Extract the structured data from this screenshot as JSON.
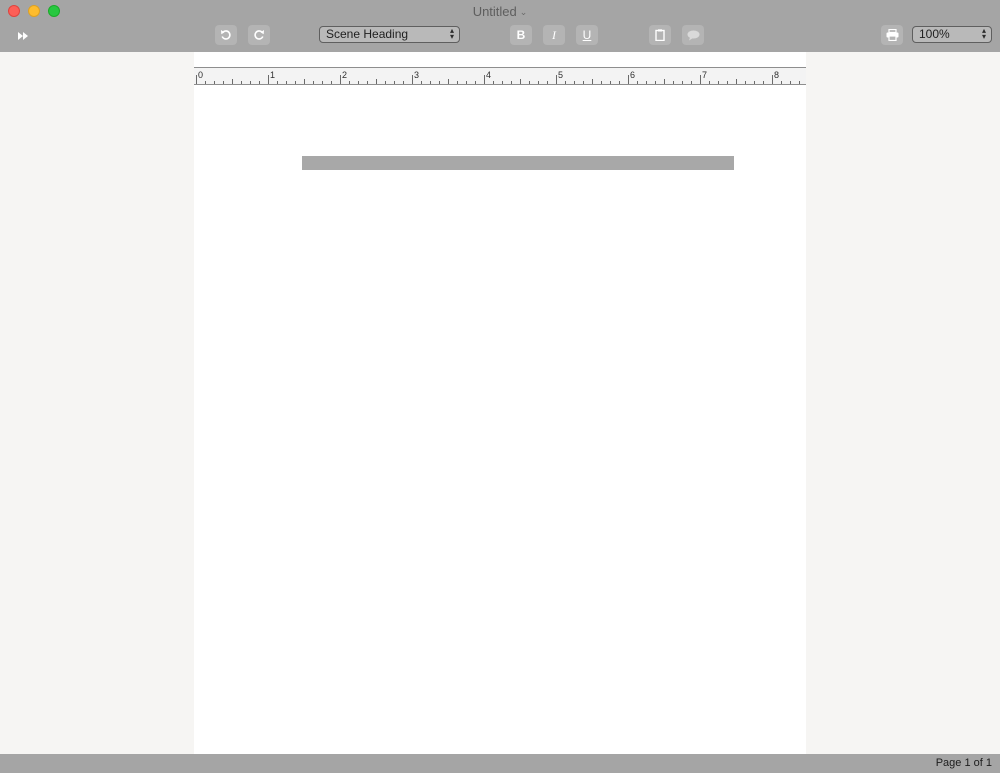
{
  "window": {
    "title": "Untitled"
  },
  "toolbar": {
    "element_type": {
      "selected": "Scene Heading"
    },
    "bold_label": "B",
    "italic_label": "I",
    "underline_label": "U",
    "zoom": {
      "selected": "100%"
    }
  },
  "ruler": {
    "labels": [
      "0",
      "1",
      "2",
      "3",
      "4",
      "5",
      "6",
      "7",
      "8"
    ]
  },
  "status": {
    "page_indicator": "Page 1 of 1"
  },
  "icons": [
    "fast-forward-icon",
    "undo-icon",
    "redo-icon",
    "clipboard-icon",
    "comment-icon",
    "printer-icon"
  ],
  "colors": {
    "chrome": "#a5a5a5",
    "page": "#ffffff",
    "background": "#f6f5f3",
    "highlight": "#a8a8a8"
  }
}
